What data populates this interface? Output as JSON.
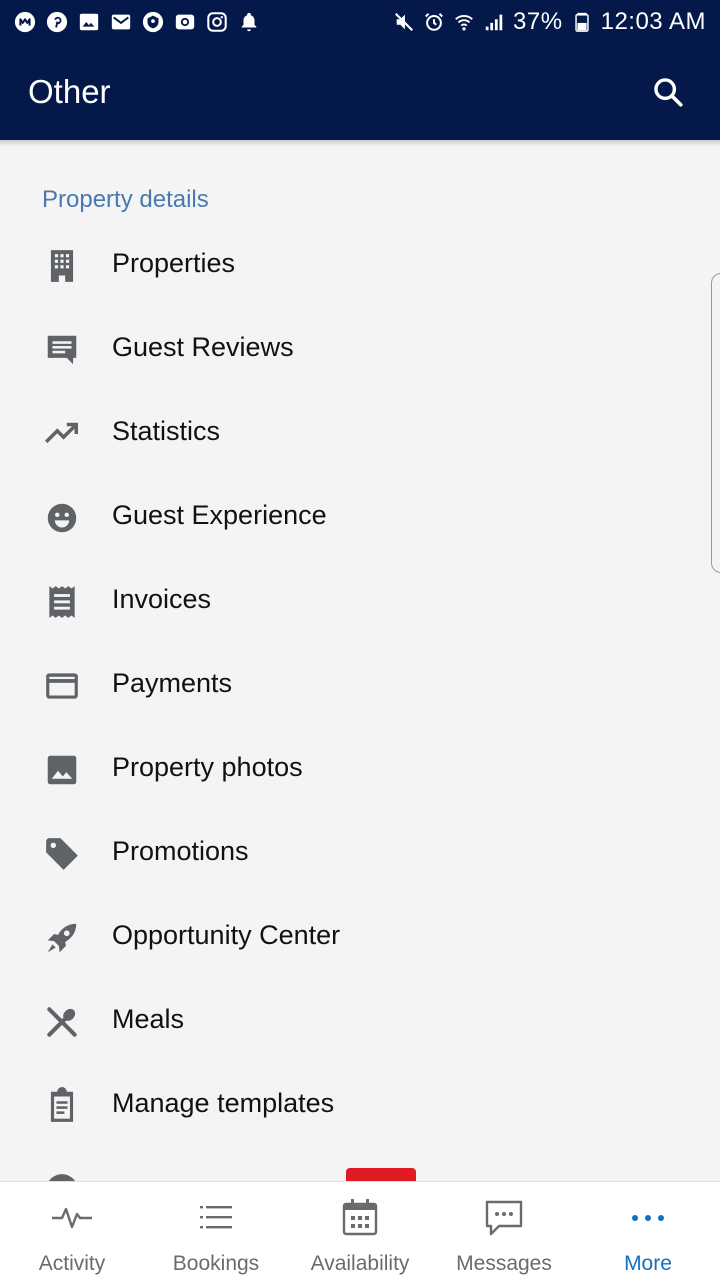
{
  "status_bar": {
    "battery": "37%",
    "time": "12:03 AM",
    "left_icons": [
      "mastodon-icon",
      "pinterest-icon",
      "gallery-icon",
      "gmail-icon",
      "vpn-icon",
      "email-icon",
      "instagram-icon",
      "bell-icon"
    ],
    "right_icons": [
      "mute-icon",
      "alarm-icon",
      "wifi-icon",
      "signal-icon",
      "battery-icon"
    ]
  },
  "app_bar": {
    "title": "Other",
    "search_icon": "search-icon"
  },
  "section": {
    "title": "Property details"
  },
  "menu": {
    "items": [
      {
        "label": "Properties",
        "icon": "building-icon"
      },
      {
        "label": "Guest Reviews",
        "icon": "review-icon"
      },
      {
        "label": "Statistics",
        "icon": "trending-up-icon"
      },
      {
        "label": "Guest Experience",
        "icon": "smiley-icon"
      },
      {
        "label": "Invoices",
        "icon": "receipt-icon"
      },
      {
        "label": "Payments",
        "icon": "credit-card-icon"
      },
      {
        "label": "Property photos",
        "icon": "image-icon"
      },
      {
        "label": "Promotions",
        "icon": "tag-icon"
      },
      {
        "label": "Opportunity Center",
        "icon": "rocket-icon"
      },
      {
        "label": "Meals",
        "icon": "utensils-icon"
      },
      {
        "label": "Manage templates",
        "icon": "clipboard-icon"
      }
    ]
  },
  "bottom_nav": {
    "items": [
      {
        "label": "Activity",
        "icon": "activity-icon",
        "active": false
      },
      {
        "label": "Bookings",
        "icon": "list-icon",
        "active": false
      },
      {
        "label": "Availability",
        "icon": "calendar-icon",
        "active": false
      },
      {
        "label": "Messages",
        "icon": "message-icon",
        "active": false
      },
      {
        "label": "More",
        "icon": "more-icon",
        "active": true
      }
    ]
  },
  "colors": {
    "header_bg": "#04194a",
    "section_header": "#4a78b0",
    "icon_gray": "#5f6368",
    "active_nav": "#1370c0",
    "badge_red": "#e01b24"
  }
}
